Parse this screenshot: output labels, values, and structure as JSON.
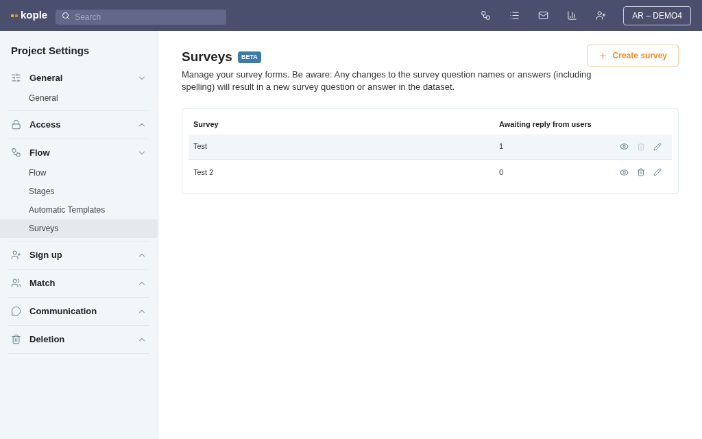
{
  "topbar": {
    "logo": "kople",
    "search": {
      "placeholder": "Search"
    },
    "account": "AR – DEMO4"
  },
  "sidebar": {
    "title": "Project Settings",
    "sections": [
      {
        "label": "General",
        "expanded": true,
        "items": [
          {
            "label": "General",
            "selected": false
          }
        ]
      },
      {
        "label": "Access",
        "expanded": false
      },
      {
        "label": "Flow",
        "expanded": true,
        "items": [
          {
            "label": "Flow",
            "selected": false
          },
          {
            "label": "Stages",
            "selected": false
          },
          {
            "label": "Automatic Templates",
            "selected": false
          },
          {
            "label": "Surveys",
            "selected": true
          }
        ]
      },
      {
        "label": "Sign up",
        "expanded": false
      },
      {
        "label": "Match",
        "expanded": false
      },
      {
        "label": "Communication",
        "expanded": false
      },
      {
        "label": "Deletion",
        "expanded": false
      }
    ]
  },
  "page": {
    "title": "Surveys",
    "badge": "BETA",
    "create_button": "Create survey",
    "description": "Manage your survey forms. Be aware: Any changes to the survey question names or answers (including spelling) will result in a new survey question or answer in the dataset.",
    "table": {
      "columns": [
        "Survey",
        "Awaiting reply from users"
      ],
      "rows": [
        {
          "name": "Test",
          "awaiting": "1",
          "highlighted": true,
          "delete_disabled": true
        },
        {
          "name": "Test 2",
          "awaiting": "0",
          "highlighted": false,
          "delete_disabled": false
        }
      ]
    }
  }
}
